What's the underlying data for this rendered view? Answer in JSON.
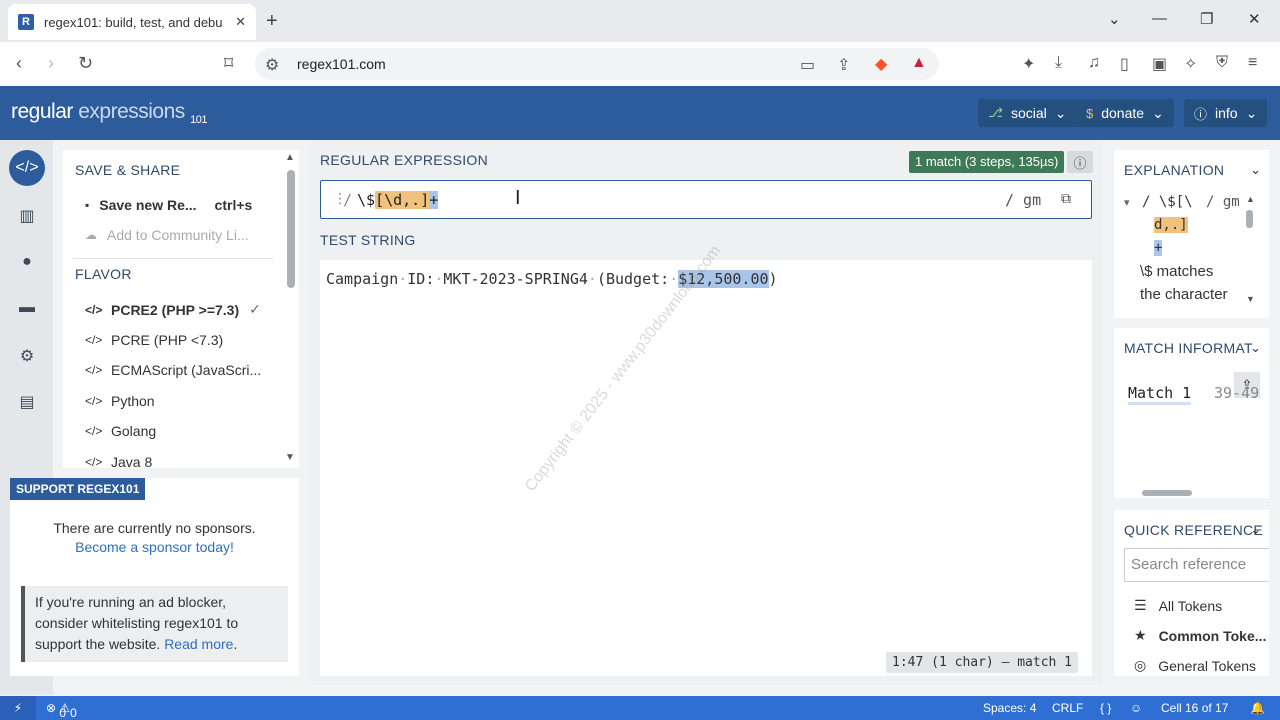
{
  "browser": {
    "tab_title": "regex101: build, test, and debu",
    "favicon_letter": "R",
    "url": "regex101.com"
  },
  "header": {
    "logo_main": "regular",
    "logo_light": "expressions",
    "logo_sub": "101",
    "social": "social",
    "donate": "donate",
    "info": "info"
  },
  "left": {
    "save_share_title": "SAVE & SHARE",
    "save_new": "Save new Re...",
    "save_shortcut": "ctrl+s",
    "add_community": "Add to Community Li...",
    "flavor_title": "FLAVOR",
    "flavors": [
      "PCRE2 (PHP >=7.3)",
      "PCRE (PHP <7.3)",
      "ECMAScript (JavaScri...",
      "Python",
      "Golang",
      "Java 8"
    ],
    "support_badge": "SUPPORT REGEX101",
    "no_sponsors": "There are currently no sponsors.",
    "become_sponsor": "Become a sponsor today!",
    "ad_text_1": "If you're running an ad blocker,",
    "ad_text_2": "consider whitelisting regex101 to",
    "ad_text_3": "support the website.",
    "read_more": "Read more"
  },
  "regex": {
    "label": "REGULAR EXPRESSION",
    "match_info": "1 match (3 steps, 135µs)",
    "delimiter": "/",
    "part1": "\\$",
    "part2": "[\\d,.]",
    "part3": "+",
    "flags": "/ gm"
  },
  "test": {
    "label": "TEST STRING",
    "before": "Campaign",
    "w2": "ID:",
    "w3": "MKT-2023-SPRING4",
    "w4": "(Budget:",
    "match": "$12,500.00",
    "after": ")",
    "status": "1:47 (1 char) — match 1",
    "watermark": "Copyright © 2025 - www.p30download.com"
  },
  "explanation": {
    "title": "EXPLANATION",
    "regex_a": "\\$[\\",
    "regex_b": "d,.]",
    "regex_c": "+",
    "flags": "/ gm",
    "slash": "/",
    "text_1": "\\$ matches",
    "text_2": "the character"
  },
  "match_info": {
    "title": "MATCH INFORMAT",
    "match_label": "Match 1",
    "match_range": "39-49"
  },
  "quick_ref": {
    "title": "QUICK REFERENCE",
    "search_placeholder": "Search reference",
    "items": [
      "All Tokens",
      "Common Toke...",
      "General Tokens"
    ]
  },
  "statusbar": {
    "problems": "0",
    "warnings": "0",
    "spaces": "Spaces: 4",
    "eol": "CRLF",
    "cell": "Cell 16 of 17"
  }
}
